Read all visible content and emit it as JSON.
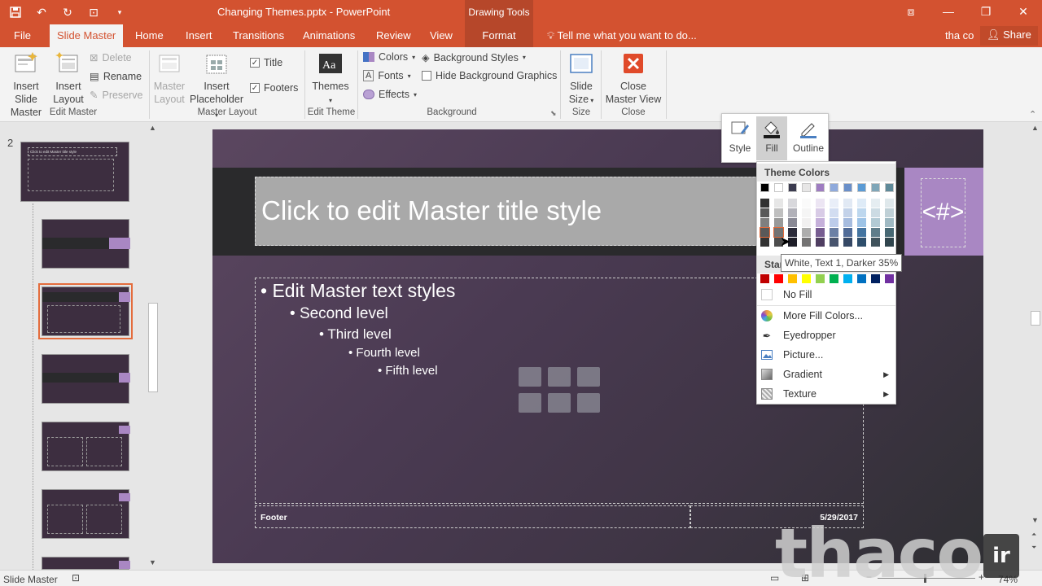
{
  "window": {
    "title": "Changing Themes.pptx - PowerPoint",
    "context_tab_group": "Drawing Tools",
    "user": "tha co",
    "share": "Share",
    "tell_me": "Tell me what you want to do..."
  },
  "tabs": [
    "File",
    "Slide Master",
    "Home",
    "Insert",
    "Transitions",
    "Animations",
    "Review",
    "View",
    "Format"
  ],
  "ribbon": {
    "edit_master": {
      "label": "Edit Master",
      "insert_slide_master": "Insert Slide Master",
      "insert_layout": "Insert Layout",
      "delete": "Delete",
      "rename": "Rename",
      "preserve": "Preserve"
    },
    "master_layout": {
      "label": "Master Layout",
      "master_layout": "Master Layout",
      "insert_placeholder": "Insert Placeholder",
      "title": "Title",
      "footers": "Footers"
    },
    "edit_theme": {
      "label": "Edit Theme",
      "themes": "Themes"
    },
    "background": {
      "label": "Background",
      "colors": "Colors",
      "fonts": "Fonts",
      "effects": "Effects",
      "background_styles": "Background Styles",
      "hide_background_graphics": "Hide Background Graphics"
    },
    "size": {
      "label": "Size",
      "slide_size": "Slide Size"
    },
    "close": {
      "label": "Close",
      "close_master_view": "Close Master View"
    }
  },
  "thumbnails": {
    "slide_number": "2",
    "master_title": "Click to edit Master title style"
  },
  "slide": {
    "title": "Click to edit Master title style",
    "number_placeholder": "<#>",
    "levels": [
      "Edit Master text styles",
      "Second level",
      "Third level",
      "Fourth level",
      "Fifth level"
    ],
    "footer": "Footer",
    "date": "5/29/2017"
  },
  "mini_toolbar": {
    "style": "Style",
    "fill": "Fill",
    "outline": "Outline"
  },
  "fill_menu": {
    "theme_colors": "Theme Colors",
    "standard_colors_partial": "Stan",
    "tooltip": "White, Text 1, Darker 35%",
    "items": [
      "No Fill",
      "More Fill Colors...",
      "Eyedropper",
      "Picture...",
      "Gradient",
      "Texture"
    ],
    "theme_base": [
      "#000000",
      "#ffffff",
      "#3b3b4f",
      "#e7e6e6",
      "#9e7cc1",
      "#8faadc",
      "#6a8fc9",
      "#5b9bd5",
      "#7fa6b8",
      "#5f8a99"
    ],
    "standard": [
      "#c00000",
      "#ff0000",
      "#ffc000",
      "#ffff00",
      "#92d050",
      "#00b050",
      "#00b0f0",
      "#0070c0",
      "#002060",
      "#7030a0"
    ]
  },
  "statusbar": {
    "mode": "Slide Master",
    "zoom": "74%"
  },
  "watermark": {
    "text": "thaco",
    "badge": "ir"
  }
}
